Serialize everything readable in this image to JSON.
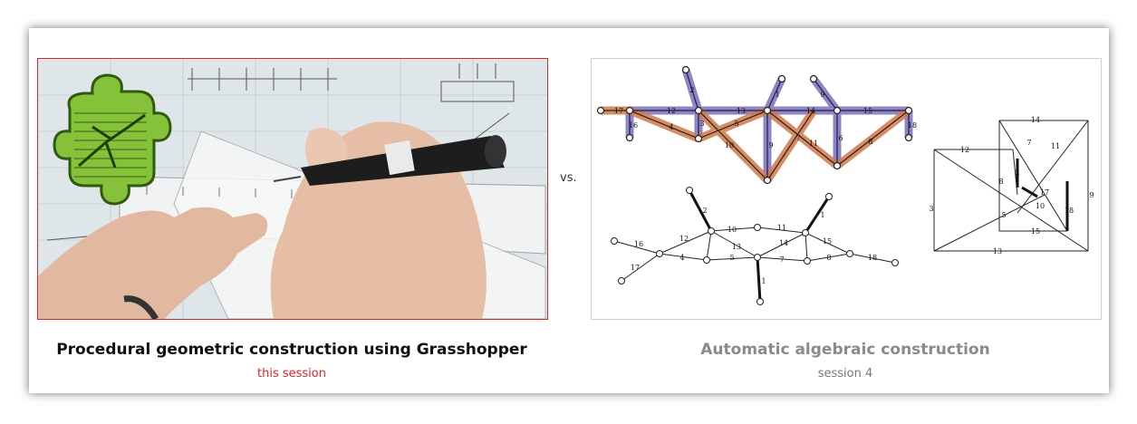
{
  "slide": {
    "vs_label": "vs.",
    "left": {
      "title": "Procedural geometric construction using Grasshopper",
      "subtitle": "this session",
      "accent_color": "#d9232a"
    },
    "right": {
      "title": "Automatic algebraic construction",
      "subtitle": "session 4"
    }
  },
  "diagrams": {
    "member_labels": [
      "1",
      "2",
      "3",
      "4",
      "5",
      "6",
      "7",
      "8",
      "9",
      "10",
      "11",
      "12",
      "13",
      "14",
      "15",
      "16",
      "17",
      "18"
    ],
    "colors": {
      "compression": "#7b6fc4",
      "tension": "#d2784a"
    }
  },
  "icons": {
    "grasshopper_logo": "grasshopper-puzzle-icon"
  }
}
